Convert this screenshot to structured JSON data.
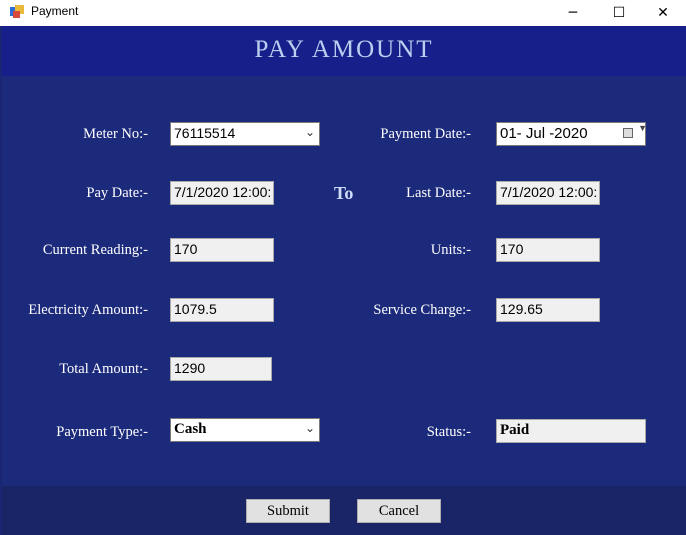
{
  "window": {
    "title": "Payment",
    "minimize": "─",
    "maximize": "☐",
    "close": "✕"
  },
  "header": {
    "title": "PAY AMOUNT"
  },
  "form": {
    "meter_no_label": "Meter No:-",
    "meter_no_value": "76115514",
    "payment_date_label": "Payment Date:-",
    "payment_date_value": "01- Jul -2020",
    "pay_date_label": "Pay Date:-",
    "pay_date_value": "7/1/2020 12:00:",
    "to_label": "To",
    "last_date_label": "Last Date:-",
    "last_date_value": "7/1/2020 12:00:",
    "current_reading_label": "Current Reading:-",
    "current_reading_value": "170",
    "units_label": "Units:-",
    "units_value": "170",
    "electricity_amount_label": "Electricity Amount:-",
    "electricity_amount_value": "1079.5",
    "service_charge_label": "Service Charge:-",
    "service_charge_value": "129.65",
    "total_amount_label": "Total Amount:-",
    "total_amount_value": "1290",
    "payment_type_label": "Payment Type:-",
    "payment_type_value": "Cash",
    "status_label": "Status:-",
    "status_value": "Paid"
  },
  "buttons": {
    "submit": "Submit",
    "cancel": "Cancel"
  },
  "colors": {
    "header_bg": "#17208a",
    "body_bg": "#1c2a7b",
    "footer_bg": "#192566",
    "title_text": "#b9cff0"
  }
}
